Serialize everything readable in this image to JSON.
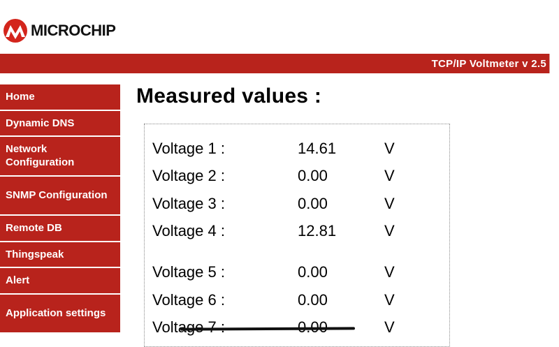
{
  "brand": {
    "logo_text": "MICROCHIP",
    "logo_icon": "microchip-logo-icon",
    "accent_color": "#b8231c"
  },
  "header": {
    "title": "TCP/IP Voltmeter v 2.5"
  },
  "sidebar": {
    "items": [
      {
        "label": "Home"
      },
      {
        "label": "Dynamic DNS"
      },
      {
        "label": "Network Configuration"
      },
      {
        "label": "SNMP Configuration"
      },
      {
        "label": "Remote DB"
      },
      {
        "label": "Thingspeak"
      },
      {
        "label": "Alert"
      },
      {
        "label": "Application settings"
      }
    ]
  },
  "main": {
    "title": "Measured values :",
    "readings": [
      {
        "label": "Voltage 1 :",
        "value": "14.61",
        "unit": "V"
      },
      {
        "label": "Voltage 2 :",
        "value": "0.00",
        "unit": "V"
      },
      {
        "label": "Voltage 3 :",
        "value": "0.00",
        "unit": "V"
      },
      {
        "label": "Voltage 4 :",
        "value": "12.81",
        "unit": "V"
      },
      {
        "label": "Voltage 5 :",
        "value": "0.00",
        "unit": "V"
      },
      {
        "label": "Voltage 6 :",
        "value": "0.00",
        "unit": "V"
      },
      {
        "label": "Voltage 7 :",
        "value": "0.00",
        "unit": "V"
      }
    ]
  }
}
